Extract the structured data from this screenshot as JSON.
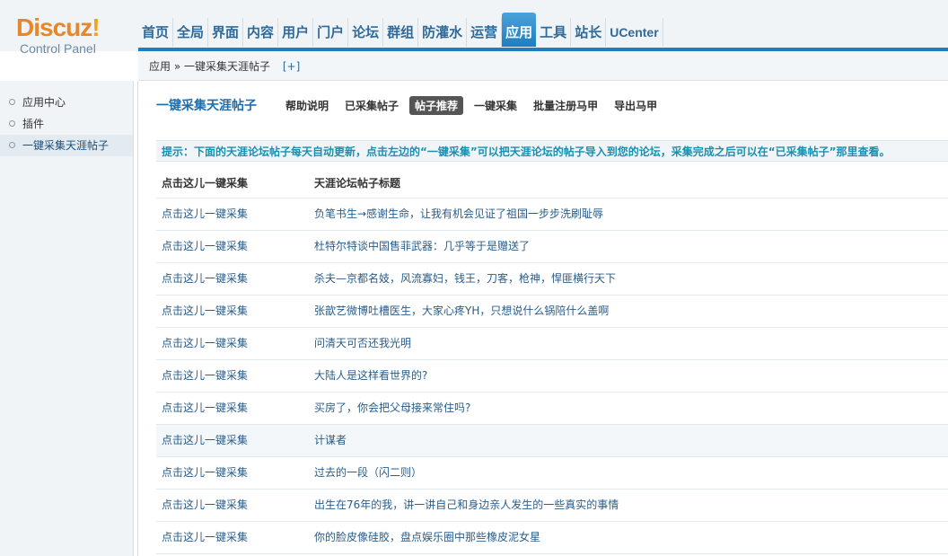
{
  "logo": {
    "brand": "Discuz",
    "bang": "!",
    "subtitle": "Control Panel"
  },
  "nav": [
    {
      "label": "首页"
    },
    {
      "label": "全局"
    },
    {
      "label": "界面"
    },
    {
      "label": "内容"
    },
    {
      "label": "用户"
    },
    {
      "label": "门户"
    },
    {
      "label": "论坛"
    },
    {
      "label": "群组"
    },
    {
      "label": "防灌水"
    },
    {
      "label": "运营"
    },
    {
      "label": "应用",
      "active": true
    },
    {
      "label": "工具"
    },
    {
      "label": "站长"
    },
    {
      "label": "UCenter"
    }
  ],
  "breadcrumb": {
    "root": "应用",
    "sep": "»",
    "current": "一键采集天涯帖子",
    "add": "[+]"
  },
  "sidebar": {
    "items": [
      {
        "label": "应用中心"
      },
      {
        "label": "插件"
      },
      {
        "label": "一键采集天涯帖子",
        "active": true
      }
    ]
  },
  "subnav": {
    "title": "一键采集天涯帖子",
    "tabs": [
      {
        "label": "帮助说明"
      },
      {
        "label": "已采集帖子"
      },
      {
        "label": "帖子推荐",
        "active": true
      },
      {
        "label": "一键采集"
      },
      {
        "label": "批量注册马甲"
      },
      {
        "label": "导出马甲"
      }
    ]
  },
  "tip": "提示：下面的天涯论坛帖子每天自动更新，点击左边的“一键采集”可以把天涯论坛的帖子导入到您的论坛，采集完成之后可以在“已采集帖子”那里查看。",
  "table": {
    "headers": [
      "点击这儿一键采集",
      "天涯论坛帖子标题"
    ],
    "rows": [
      {
        "action": "点击这儿一键采集",
        "title": "负笔书生→感谢生命，让我有机会见证了祖国一步步洗刷耻辱"
      },
      {
        "action": "点击这儿一键采集",
        "title": "杜特尔特谈中国售菲武器：几乎等于是赠送了"
      },
      {
        "action": "点击这儿一键采集",
        "title": "杀夫—京都名妓，风流寡妇，钱王，刀客，枪神，悍匪横行天下"
      },
      {
        "action": "点击这儿一键采集",
        "title": "张歆艺微博吐槽医生，大家心疼YH，只想说什么锅陪什么盖啊"
      },
      {
        "action": "点击这儿一键采集",
        "title": "问清天可否还我光明"
      },
      {
        "action": "点击这儿一键采集",
        "title": "大陆人是这样看世界的?"
      },
      {
        "action": "点击这儿一键采集",
        "title": "买房了，你会把父母接来常住吗?"
      },
      {
        "action": "点击这儿一键采集",
        "title": "计谋者",
        "highlight": true
      },
      {
        "action": "点击这儿一键采集",
        "title": "过去的一段（闪二则）"
      },
      {
        "action": "点击这儿一键采集",
        "title": "出生在76年的我，讲一讲自己和身边亲人发生的一些真实的事情"
      },
      {
        "action": "点击这儿一键采集",
        "title": "你的脸皮像硅胶，盘点娱乐圈中那些橡皮泥女星"
      }
    ]
  }
}
